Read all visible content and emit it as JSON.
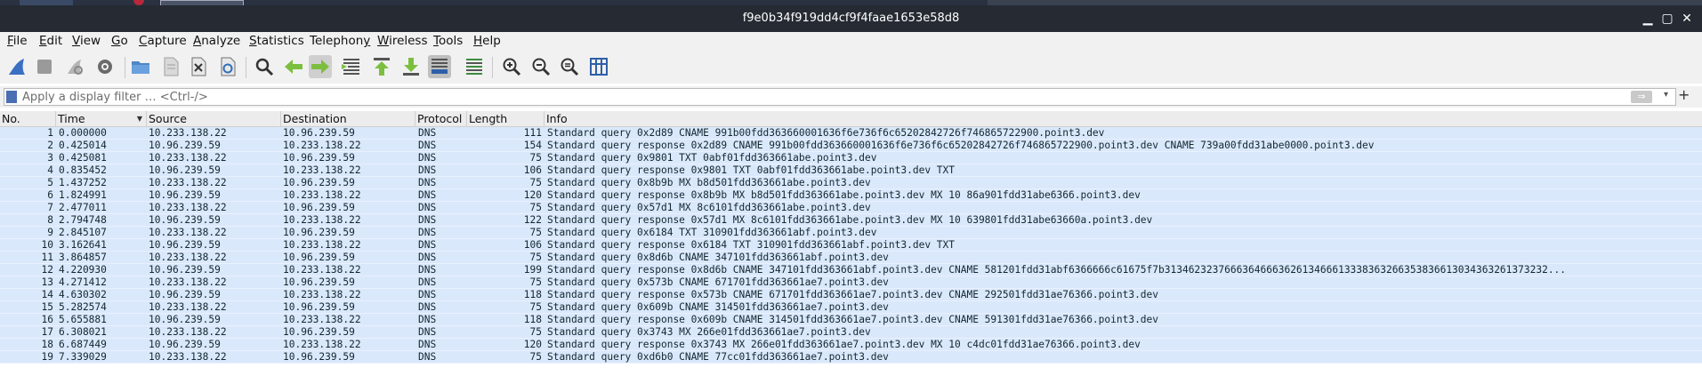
{
  "window": {
    "title": "f9e0b34f919dd4cf9f4faae1653e58d8",
    "controls": {
      "minimize": "▁",
      "restore": "▢",
      "close": "✕"
    }
  },
  "menu": [
    "File",
    "Edit",
    "View",
    "Go",
    "Capture",
    "Analyze",
    "Statistics",
    "Telephony",
    "Wireless",
    "Tools",
    "Help"
  ],
  "menu_mnemonic": [
    "F",
    "E",
    "V",
    "G",
    "C",
    "A",
    "S",
    "y",
    "W",
    "T",
    "H"
  ],
  "toolbar_icons": [
    "shark-fin-start-icon",
    "stop-capture-icon",
    "restart-capture-icon",
    "capture-options-gear-icon",
    "open-file-folder-icon",
    "save-file-icon",
    "close-file-icon",
    "reload-file-icon",
    "find-packet-icon",
    "go-back-arrow-icon",
    "go-forward-arrow-icon",
    "go-to-packet-icon",
    "go-first-packet-icon",
    "go-last-packet-icon",
    "auto-scroll-icon",
    "colorize-icon",
    "zoom-in-icon",
    "zoom-out-icon",
    "zoom-normal-icon",
    "resize-columns-icon"
  ],
  "filter": {
    "placeholder": "Apply a display filter … <Ctrl-/>",
    "apply_glyph": "⇒",
    "dropdown_glyph": "▾",
    "add_glyph": "+"
  },
  "columns": [
    "No.",
    "Time",
    "Source",
    "Destination",
    "Protocol",
    "Length",
    "Info"
  ],
  "sort_indicator": "▼",
  "colors": {
    "row_bg": "#dae8fc",
    "row_text": "#12272e",
    "titlebar": "#252a33"
  },
  "packets": [
    {
      "no": "1",
      "time": "0.000000",
      "src": "10.233.138.22",
      "dst": "10.96.239.59",
      "proto": "DNS",
      "len": "111",
      "info": "Standard query 0x2d89 CNAME 991b00fdd363660001636f6e736f6c65202842726f746865722900.point3.dev"
    },
    {
      "no": "2",
      "time": "0.425014",
      "src": "10.96.239.59",
      "dst": "10.233.138.22",
      "proto": "DNS",
      "len": "154",
      "info": "Standard query response 0x2d89 CNAME 991b00fdd363660001636f6e736f6c65202842726f746865722900.point3.dev CNAME 739a00fdd31abe0000.point3.dev"
    },
    {
      "no": "3",
      "time": "0.425081",
      "src": "10.233.138.22",
      "dst": "10.96.239.59",
      "proto": "DNS",
      "len": "75",
      "info": "Standard query 0x9801 TXT 0abf01fdd363661abe.point3.dev"
    },
    {
      "no": "4",
      "time": "0.835452",
      "src": "10.96.239.59",
      "dst": "10.233.138.22",
      "proto": "DNS",
      "len": "106",
      "info": "Standard query response 0x9801 TXT 0abf01fdd363661abe.point3.dev TXT"
    },
    {
      "no": "5",
      "time": "1.437252",
      "src": "10.233.138.22",
      "dst": "10.96.239.59",
      "proto": "DNS",
      "len": "75",
      "info": "Standard query 0x8b9b MX b8d501fdd363661abe.point3.dev"
    },
    {
      "no": "6",
      "time": "1.824991",
      "src": "10.96.239.59",
      "dst": "10.233.138.22",
      "proto": "DNS",
      "len": "120",
      "info": "Standard query response 0x8b9b MX b8d501fdd363661abe.point3.dev MX 10 86a901fdd31abe6366.point3.dev"
    },
    {
      "no": "7",
      "time": "2.477011",
      "src": "10.233.138.22",
      "dst": "10.96.239.59",
      "proto": "DNS",
      "len": "75",
      "info": "Standard query 0x57d1 MX 8c6101fdd363661abe.point3.dev"
    },
    {
      "no": "8",
      "time": "2.794748",
      "src": "10.96.239.59",
      "dst": "10.233.138.22",
      "proto": "DNS",
      "len": "122",
      "info": "Standard query response 0x57d1 MX 8c6101fdd363661abe.point3.dev MX 10 639801fdd31abe63660a.point3.dev"
    },
    {
      "no": "9",
      "time": "2.845107",
      "src": "10.233.138.22",
      "dst": "10.96.239.59",
      "proto": "DNS",
      "len": "75",
      "info": "Standard query 0x6184 TXT 310901fdd363661abf.point3.dev"
    },
    {
      "no": "10",
      "time": "3.162641",
      "src": "10.96.239.59",
      "dst": "10.233.138.22",
      "proto": "DNS",
      "len": "106",
      "info": "Standard query response 0x6184 TXT 310901fdd363661abf.point3.dev TXT"
    },
    {
      "no": "11",
      "time": "3.864857",
      "src": "10.233.138.22",
      "dst": "10.96.239.59",
      "proto": "DNS",
      "len": "75",
      "info": "Standard query 0x8d6b CNAME 347101fdd363661abf.point3.dev"
    },
    {
      "no": "12",
      "time": "4.220930",
      "src": "10.96.239.59",
      "dst": "10.233.138.22",
      "proto": "DNS",
      "len": "199",
      "info": "Standard query response 0x8d6b CNAME 347101fdd363661abf.point3.dev CNAME 581201fdd31abf6366666c61675f7b3134623237666364666362613466613338363266353836613034363261373232...​"
    },
    {
      "no": "13",
      "time": "4.271412",
      "src": "10.233.138.22",
      "dst": "10.96.239.59",
      "proto": "DNS",
      "len": "75",
      "info": "Standard query 0x573b CNAME 671701fdd363661ae7.point3.dev"
    },
    {
      "no": "14",
      "time": "4.630302",
      "src": "10.96.239.59",
      "dst": "10.233.138.22",
      "proto": "DNS",
      "len": "118",
      "info": "Standard query response 0x573b CNAME 671701fdd363661ae7.point3.dev CNAME 292501fdd31ae76366.point3.dev"
    },
    {
      "no": "15",
      "time": "5.282574",
      "src": "10.233.138.22",
      "dst": "10.96.239.59",
      "proto": "DNS",
      "len": "75",
      "info": "Standard query 0x609b CNAME 314501fdd363661ae7.point3.dev"
    },
    {
      "no": "16",
      "time": "5.655881",
      "src": "10.96.239.59",
      "dst": "10.233.138.22",
      "proto": "DNS",
      "len": "118",
      "info": "Standard query response 0x609b CNAME 314501fdd363661ae7.point3.dev CNAME 591301fdd31ae76366.point3.dev"
    },
    {
      "no": "17",
      "time": "6.308021",
      "src": "10.233.138.22",
      "dst": "10.96.239.59",
      "proto": "DNS",
      "len": "75",
      "info": "Standard query 0x3743 MX 266e01fdd363661ae7.point3.dev"
    },
    {
      "no": "18",
      "time": "6.687449",
      "src": "10.96.239.59",
      "dst": "10.233.138.22",
      "proto": "DNS",
      "len": "120",
      "info": "Standard query response 0x3743 MX 266e01fdd363661ae7.point3.dev MX 10 c4dc01fdd31ae76366.point3.dev"
    },
    {
      "no": "19",
      "time": "7.339029",
      "src": "10.233.138.22",
      "dst": "10.96.239.59",
      "proto": "DNS",
      "len": "75",
      "info": "Standard query 0xd6b0 CNAME 77cc01fdd363661ae7.point3.dev"
    }
  ]
}
